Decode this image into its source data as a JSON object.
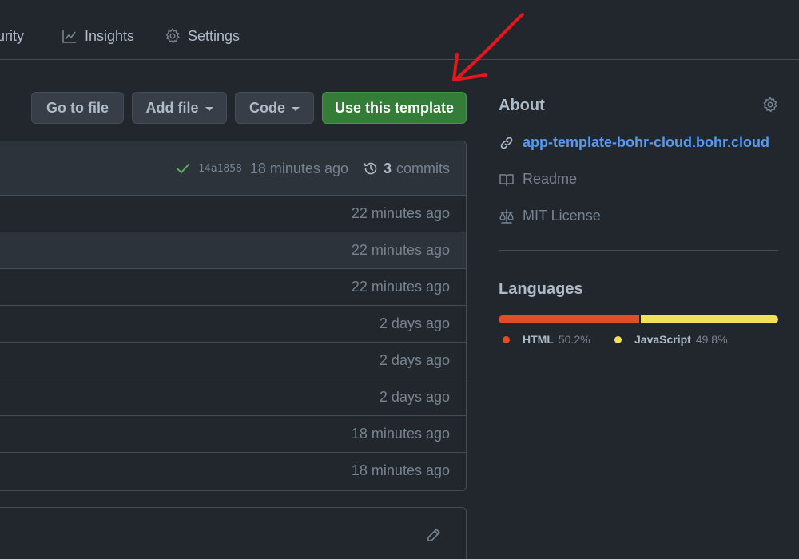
{
  "nav": {
    "tabs": [
      {
        "label": "urity",
        "icon": "shield-icon"
      },
      {
        "label": "Insights",
        "icon": "graph-icon"
      },
      {
        "label": "Settings",
        "icon": "gear-icon"
      }
    ]
  },
  "actions": {
    "go_to_file": "Go to file",
    "add_file": "Add file",
    "code": "Code",
    "use_template": "Use this template"
  },
  "commit": {
    "sha": "14a1858",
    "time": "18 minutes ago",
    "count": "3",
    "count_label": "commits"
  },
  "files": [
    {
      "age": "22 minutes ago"
    },
    {
      "age": "22 minutes ago"
    },
    {
      "age": "22 minutes ago"
    },
    {
      "age": "2 days ago"
    },
    {
      "age": "2 days ago"
    },
    {
      "age": "2 days ago"
    },
    {
      "age": "18 minutes ago"
    },
    {
      "age": "18 minutes ago"
    }
  ],
  "about": {
    "title": "About",
    "homepage": "app-template-bohr-cloud.bohr.cloud",
    "readme": "Readme",
    "license": "MIT License"
  },
  "languages": {
    "title": "Languages",
    "items": [
      {
        "name": "HTML",
        "percent": "50.2%",
        "value": 50.2,
        "color": "#e34c26"
      },
      {
        "name": "JavaScript",
        "percent": "49.8%",
        "value": 49.8,
        "color": "#f1e05a"
      }
    ]
  },
  "colors": {
    "annotation": "#e8161b",
    "primary": "#347d39",
    "link": "#539bf5",
    "check": "#57ab5a"
  }
}
